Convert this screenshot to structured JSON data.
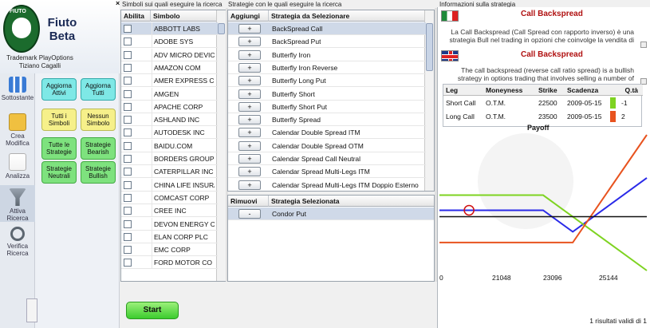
{
  "app": {
    "name_line1": "Fiuto",
    "name_line2": "Beta",
    "trademark": "Trademark PlayOptions",
    "author": "Tiziano Cagalli",
    "logo_text": "FIUTO"
  },
  "nav": [
    {
      "label": "Sottostante",
      "icon": "bar-chart-icon"
    },
    {
      "label": "Crea\nModifica",
      "icon": "folder-edit-icon"
    },
    {
      "label": "Analizza",
      "icon": "analyze-chart-icon"
    },
    {
      "label": "Attiva\nRicerca",
      "icon": "funnel-icon"
    },
    {
      "label": "Verifica\nRicerca",
      "icon": "magnifier-icon"
    }
  ],
  "quick_buttons": [
    {
      "label": "Aggiorna Attivi",
      "color": "cyan"
    },
    {
      "label": "Aggiorna Tutti",
      "color": "cyan"
    },
    {
      "label": "Tutti i Simboli",
      "color": "yellow"
    },
    {
      "label": "Nessun Simbolo",
      "color": "yellow"
    },
    {
      "label": "Tutte le Strategie",
      "color": "green"
    },
    {
      "label": "Strategie Bearish",
      "color": "green"
    },
    {
      "label": "Strategie Neutrali",
      "color": "green"
    },
    {
      "label": "Strategie Bullish",
      "color": "green"
    }
  ],
  "symbols_panel": {
    "title": "Simboli sui quali eseguire la ricerca",
    "col_enable": "Abilita",
    "col_symbol": "Simbolo",
    "rows": [
      "ABBOTT LABS",
      "ADOBE SYS",
      "ADV MICRO DEVICE",
      "AMAZON COM",
      "AMER EXPRESS CO",
      "AMGEN",
      "APACHE CORP",
      "ASHLAND INC",
      "AUTODESK INC",
      "BAIDU.COM",
      "BORDERS GROUP",
      "CATERPILLAR INC",
      "CHINA LIFE INSURAN",
      "COMCAST CORP",
      "CREE INC",
      "DEVON ENERGY CORF",
      "ELAN CORP PLC",
      "EMC CORP",
      "FORD MOTOR CO"
    ]
  },
  "strategies_panel": {
    "title": "Strategie con le quali eseguire la ricerca",
    "col_add": "Aggiungi",
    "col_strategy": "Strategia da Selezionare",
    "add_label": "+",
    "rows": [
      "BackSpread Call",
      "BackSpread Put",
      "Butterfly Iron",
      "Butterfly Iron Reverse",
      "Butterfly Long Put",
      "Butterfly Short",
      "Butterfly Short Put",
      "Butterfly Spread",
      "Calendar Double Spread ITM",
      "Calendar Double Spread OTM",
      "Calendar Spread Call Neutral",
      "Calendar Spread Multi-Legs  ITM",
      "Calendar Spread Multi-Legs ITM Doppio Esterno"
    ],
    "col_remove": "Rimuovi",
    "col_selected": "Strategia Selezionata",
    "remove_label": "-",
    "selected_rows": [
      "Condor Put"
    ]
  },
  "start_button": "Start",
  "info_panel": {
    "title": "Informazioni sulla strategia",
    "it_title": "Call Backspread",
    "it_desc": "La Call Backspread (Call Spread con rapporto inverso) è una strategia Bull nel trading in opzioni che coinvolge la vendita di",
    "en_title": "Call Backspread",
    "en_desc": "The call backspread (reverse call ratio spread) is a bullish strategy in options trading that involves selling a number of",
    "legs_headers": [
      "Leg",
      "Moneyness",
      "Strike",
      "Scadenza",
      "Q.tà"
    ],
    "legs": [
      {
        "leg": "Short Call",
        "moneyness": "O.T.M.",
        "strike": "22500",
        "scadenza": "2009-05-15",
        "qty": "-1",
        "color": "#7ed321"
      },
      {
        "leg": "Long Call",
        "moneyness": "O.T.M.",
        "strike": "23500",
        "scadenza": "2009-05-15",
        "qty": "2",
        "color": "#e8531f"
      }
    ],
    "payoff_title": "Payoff",
    "results": "1 risultati validi di 1"
  },
  "chart_data": {
    "type": "line",
    "title": "Payoff",
    "x_ticks": [
      "0",
      "21048",
      "23096",
      "25144"
    ],
    "series": [
      {
        "color": "#2a2ae8",
        "x": [
          19000,
          22500,
          23500,
          26000
        ],
        "y": [
          0.3,
          0.3,
          -0.7,
          1.8
        ]
      },
      {
        "color": "#7ed321",
        "x": [
          19000,
          22500,
          26000
        ],
        "y": [
          1.0,
          1.0,
          -2.5
        ]
      },
      {
        "color": "#e8531f",
        "x": [
          19000,
          23500,
          26000
        ],
        "y": [
          -1.2,
          -1.2,
          3.8
        ]
      },
      {
        "color": "#111111",
        "x": [
          19000,
          26000
        ],
        "y": [
          0,
          0
        ]
      }
    ],
    "marker": {
      "x": 20000,
      "y": 0.3,
      "color": "#d01010"
    },
    "xlim": [
      19000,
      26000
    ],
    "ylim": [
      -2.5,
      3.8
    ]
  }
}
